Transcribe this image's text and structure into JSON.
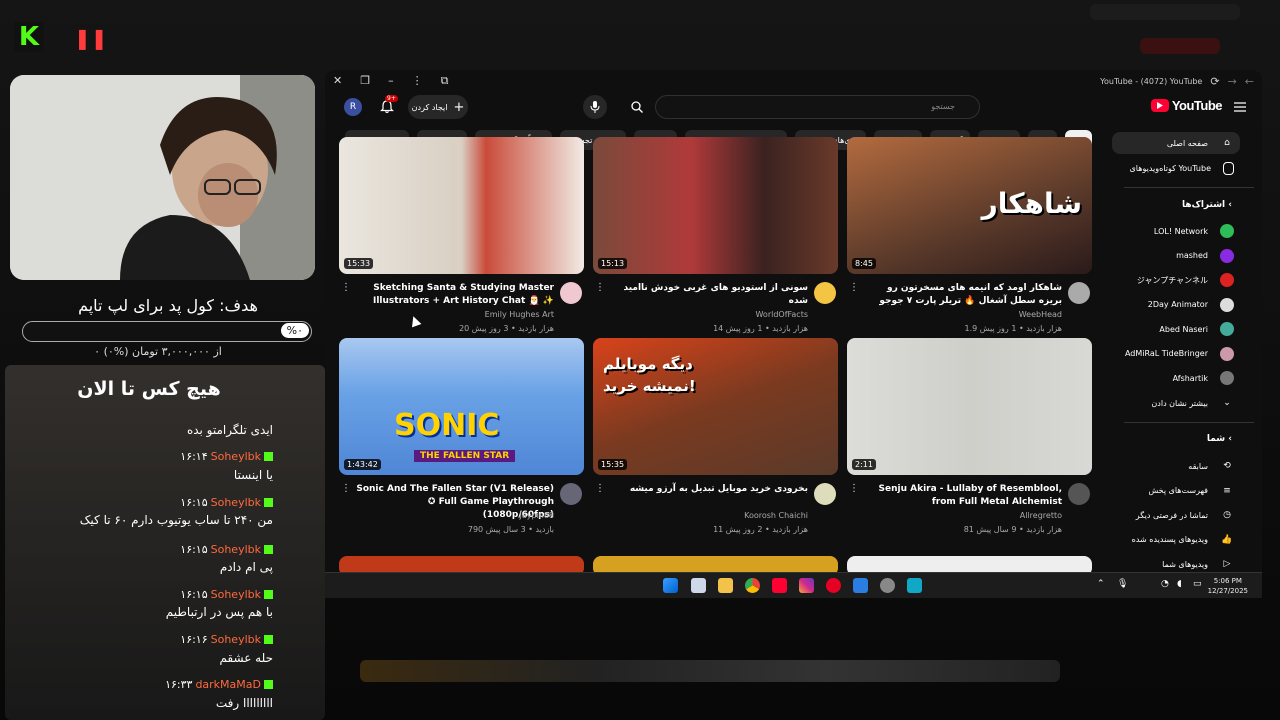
{
  "stream": {
    "goal_title": "هدف: کول پد برای لپ تاپم",
    "goal_percent": "%۰",
    "goal_progress": 0,
    "goal_sub": "۰ از ۳,۰۰۰,۰۰۰ تومان (%۰)",
    "chat_header": "هیچ کس تا الان",
    "messages": [
      {
        "text": "ایدی تلگرامتو بده"
      },
      {
        "time": "۱۶:۱۴",
        "user": "Soheylbk"
      },
      {
        "text": "یا اینستا"
      },
      {
        "time": "۱۶:۱۵",
        "user": "Soheylbk"
      },
      {
        "text": "من ۲۴۰ تا ساب یوتیوب دارم ۶۰ تا کیک"
      },
      {
        "time": "۱۶:۱۵",
        "user": "Soheylbk"
      },
      {
        "text": "پی ام دادم"
      },
      {
        "time": "۱۶:۱۵",
        "user": "Soheylbk"
      },
      {
        "text": "با هم پس در ارتباطیم"
      },
      {
        "time": "۱۶:۱۶",
        "user": "Soheylbk"
      },
      {
        "text": "حله عشقم"
      },
      {
        "time": "۱۶:۳۳",
        "user": "darkMaMaD"
      },
      {
        "text": "ااااااااا رفت"
      }
    ]
  },
  "browser": {
    "tab_title": "YouTube - (4072) YouTube"
  },
  "masthead": {
    "search_placeholder": "جستجو",
    "create_label": "ایجاد کردن",
    "notif_count": "9+",
    "avatar_letter": "R",
    "logo_text": "YouTube"
  },
  "chips": [
    "همه",
    "بازی",
    "موسیقی",
    "گیمین‌ها",
    "پادکست‌ها",
    "بازی‌های پلتفرمی",
    "بازی‌های ماجراجویی اکشن",
    "کارتون‌ها",
    "هنرهای تجسمی",
    "اخیراً بارگذاری‌شده",
    "تماشانشده",
    "جدید برای شما"
  ],
  "videos": [
    {
      "title": "شاهکار اومد که انیمه های مسخرتون رو بریزه سطل آشغال 🔥 تریلر پارت ۷ جوجو",
      "channel": "WeebHead",
      "stats": "1.9 هزار بازدید • 1 روز پیش",
      "duration": "8:45",
      "thumb_text": "شاهکار"
    },
    {
      "title": "سونی از استودیو های غربی خودش ناامید شده",
      "channel": "WorldOfFacts",
      "stats": "14 هزار بازدید • 1 روز پیش",
      "duration": "15:13"
    },
    {
      "title": "Sketching Santa & Studying Master Illustrators + Art History Chat 🎅 ✨",
      "channel": "Emily Hughes Art",
      "stats": "20 هزار بازدید • 3 روز پیش",
      "duration": "15:33"
    },
    {
      "title": "Senju Akira - Lullaby of Resemblool, from Full Metal Alchemist",
      "channel": "Allregretto",
      "stats": "81 هزار بازدید • 9 سال پیش",
      "duration": "2:11"
    },
    {
      "title": "بخرودی خرید موبایل تبدیل به آرزو میشه",
      "channel": "Koorosh Chaichi",
      "stats": "11 هزار بازدید • 2 روز پیش",
      "duration": "15:35",
      "thumb_text": "دیگه موبایلم نمیشه خرید!"
    },
    {
      "title": "Sonic And The Fallen Star (V1 Release) ✪ Full Game Playthrough (1080p/60fps)",
      "channel": "Jaypin88",
      "stats": "790 بازدید • 3 سال پیش",
      "duration": "1:43:42",
      "thumb_text": "SONIC",
      "thumb_sub": "THE FALLEN STAR"
    }
  ],
  "sidebar": {
    "home": "صفحه اصلی",
    "shorts": "کوتاه‌ویدیوهای YouTube",
    "subs_header": "اشتراک‌ها",
    "subs": [
      "LOL! Network",
      "mashed",
      "ジャンプチャンネル",
      "2Day Animator",
      "Abed Naseri",
      "AdMiRaL TideBringer",
      "Afshartik"
    ],
    "show_more": "بیشتر نشان دادن",
    "you_header": "شما",
    "you_items": [
      "سابقه",
      "فهرست‌های پخش",
      "تماشا در فرصتی دیگر",
      "ویدیو‌های پسندیده شده",
      "ویدیوهای شما"
    ]
  },
  "taskbar": {
    "time": "5:06 PM",
    "date": "12/27/2025"
  },
  "colors": {
    "kick_green": "#53fc18",
    "yt_red": "#ff0033",
    "chat_user": "#ff6a3d"
  }
}
